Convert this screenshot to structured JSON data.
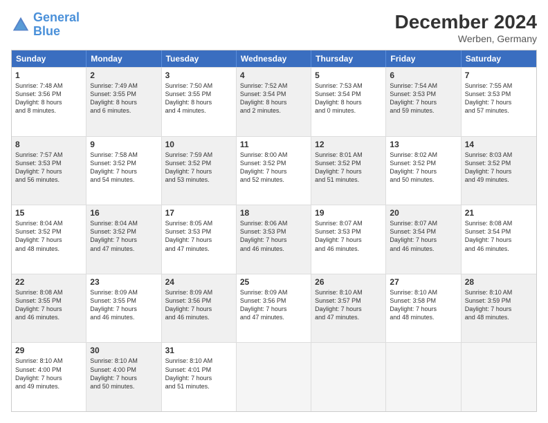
{
  "logo": {
    "line1": "General",
    "line2": "Blue"
  },
  "title": "December 2024",
  "subtitle": "Werben, Germany",
  "header_days": [
    "Sunday",
    "Monday",
    "Tuesday",
    "Wednesday",
    "Thursday",
    "Friday",
    "Saturday"
  ],
  "weeks": [
    [
      {
        "day": "1",
        "text": "Sunrise: 7:48 AM\nSunset: 3:56 PM\nDaylight: 8 hours\nand 8 minutes.",
        "shaded": false
      },
      {
        "day": "2",
        "text": "Sunrise: 7:49 AM\nSunset: 3:55 PM\nDaylight: 8 hours\nand 6 minutes.",
        "shaded": true
      },
      {
        "day": "3",
        "text": "Sunrise: 7:50 AM\nSunset: 3:55 PM\nDaylight: 8 hours\nand 4 minutes.",
        "shaded": false
      },
      {
        "day": "4",
        "text": "Sunrise: 7:52 AM\nSunset: 3:54 PM\nDaylight: 8 hours\nand 2 minutes.",
        "shaded": true
      },
      {
        "day": "5",
        "text": "Sunrise: 7:53 AM\nSunset: 3:54 PM\nDaylight: 8 hours\nand 0 minutes.",
        "shaded": false
      },
      {
        "day": "6",
        "text": "Sunrise: 7:54 AM\nSunset: 3:53 PM\nDaylight: 7 hours\nand 59 minutes.",
        "shaded": true
      },
      {
        "day": "7",
        "text": "Sunrise: 7:55 AM\nSunset: 3:53 PM\nDaylight: 7 hours\nand 57 minutes.",
        "shaded": false
      }
    ],
    [
      {
        "day": "8",
        "text": "Sunrise: 7:57 AM\nSunset: 3:53 PM\nDaylight: 7 hours\nand 56 minutes.",
        "shaded": true
      },
      {
        "day": "9",
        "text": "Sunrise: 7:58 AM\nSunset: 3:52 PM\nDaylight: 7 hours\nand 54 minutes.",
        "shaded": false
      },
      {
        "day": "10",
        "text": "Sunrise: 7:59 AM\nSunset: 3:52 PM\nDaylight: 7 hours\nand 53 minutes.",
        "shaded": true
      },
      {
        "day": "11",
        "text": "Sunrise: 8:00 AM\nSunset: 3:52 PM\nDaylight: 7 hours\nand 52 minutes.",
        "shaded": false
      },
      {
        "day": "12",
        "text": "Sunrise: 8:01 AM\nSunset: 3:52 PM\nDaylight: 7 hours\nand 51 minutes.",
        "shaded": true
      },
      {
        "day": "13",
        "text": "Sunrise: 8:02 AM\nSunset: 3:52 PM\nDaylight: 7 hours\nand 50 minutes.",
        "shaded": false
      },
      {
        "day": "14",
        "text": "Sunrise: 8:03 AM\nSunset: 3:52 PM\nDaylight: 7 hours\nand 49 minutes.",
        "shaded": true
      }
    ],
    [
      {
        "day": "15",
        "text": "Sunrise: 8:04 AM\nSunset: 3:52 PM\nDaylight: 7 hours\nand 48 minutes.",
        "shaded": false
      },
      {
        "day": "16",
        "text": "Sunrise: 8:04 AM\nSunset: 3:52 PM\nDaylight: 7 hours\nand 47 minutes.",
        "shaded": true
      },
      {
        "day": "17",
        "text": "Sunrise: 8:05 AM\nSunset: 3:53 PM\nDaylight: 7 hours\nand 47 minutes.",
        "shaded": false
      },
      {
        "day": "18",
        "text": "Sunrise: 8:06 AM\nSunset: 3:53 PM\nDaylight: 7 hours\nand 46 minutes.",
        "shaded": true
      },
      {
        "day": "19",
        "text": "Sunrise: 8:07 AM\nSunset: 3:53 PM\nDaylight: 7 hours\nand 46 minutes.",
        "shaded": false
      },
      {
        "day": "20",
        "text": "Sunrise: 8:07 AM\nSunset: 3:54 PM\nDaylight: 7 hours\nand 46 minutes.",
        "shaded": true
      },
      {
        "day": "21",
        "text": "Sunrise: 8:08 AM\nSunset: 3:54 PM\nDaylight: 7 hours\nand 46 minutes.",
        "shaded": false
      }
    ],
    [
      {
        "day": "22",
        "text": "Sunrise: 8:08 AM\nSunset: 3:55 PM\nDaylight: 7 hours\nand 46 minutes.",
        "shaded": true
      },
      {
        "day": "23",
        "text": "Sunrise: 8:09 AM\nSunset: 3:55 PM\nDaylight: 7 hours\nand 46 minutes.",
        "shaded": false
      },
      {
        "day": "24",
        "text": "Sunrise: 8:09 AM\nSunset: 3:56 PM\nDaylight: 7 hours\nand 46 minutes.",
        "shaded": true
      },
      {
        "day": "25",
        "text": "Sunrise: 8:09 AM\nSunset: 3:56 PM\nDaylight: 7 hours\nand 47 minutes.",
        "shaded": false
      },
      {
        "day": "26",
        "text": "Sunrise: 8:10 AM\nSunset: 3:57 PM\nDaylight: 7 hours\nand 47 minutes.",
        "shaded": true
      },
      {
        "day": "27",
        "text": "Sunrise: 8:10 AM\nSunset: 3:58 PM\nDaylight: 7 hours\nand 48 minutes.",
        "shaded": false
      },
      {
        "day": "28",
        "text": "Sunrise: 8:10 AM\nSunset: 3:59 PM\nDaylight: 7 hours\nand 48 minutes.",
        "shaded": true
      }
    ],
    [
      {
        "day": "29",
        "text": "Sunrise: 8:10 AM\nSunset: 4:00 PM\nDaylight: 7 hours\nand 49 minutes.",
        "shaded": false
      },
      {
        "day": "30",
        "text": "Sunrise: 8:10 AM\nSunset: 4:00 PM\nDaylight: 7 hours\nand 50 minutes.",
        "shaded": true
      },
      {
        "day": "31",
        "text": "Sunrise: 8:10 AM\nSunset: 4:01 PM\nDaylight: 7 hours\nand 51 minutes.",
        "shaded": false
      },
      {
        "day": "",
        "text": "",
        "shaded": true,
        "empty": true
      },
      {
        "day": "",
        "text": "",
        "shaded": false,
        "empty": true
      },
      {
        "day": "",
        "text": "",
        "shaded": true,
        "empty": true
      },
      {
        "day": "",
        "text": "",
        "shaded": false,
        "empty": true
      }
    ]
  ]
}
